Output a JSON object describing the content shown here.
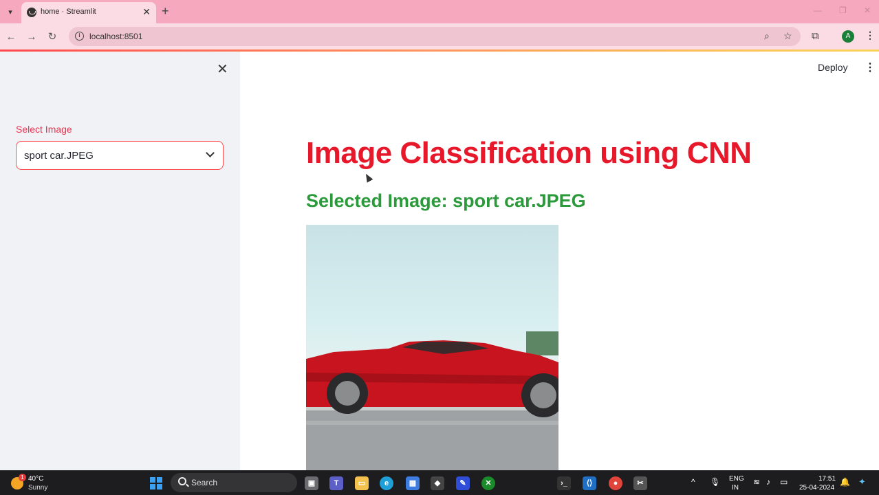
{
  "browser": {
    "tab_title": "home · Streamlit",
    "url": "localhost:8501",
    "profile_initial": "A"
  },
  "sidebar": {
    "select_label": "Select Image",
    "select_value": "sport car.JPEG"
  },
  "main": {
    "deploy_label": "Deploy",
    "title": "Image Classification using CNN",
    "subtitle": "Selected Image: sport car.JPEG",
    "image_name": "sport-car-image"
  },
  "taskbar": {
    "weather_temp": "40°C",
    "weather_desc": "Sunny",
    "weather_badge": "1",
    "search_label": "Search",
    "lang_top": "ENG",
    "lang_bottom": "IN",
    "time": "17:51",
    "date": "25-04-2024"
  },
  "colors": {
    "title": "#e8182b",
    "subtitle": "#2a9a3a",
    "select_border": "#ff4b4b",
    "tab_bar": "#f6a8be"
  }
}
